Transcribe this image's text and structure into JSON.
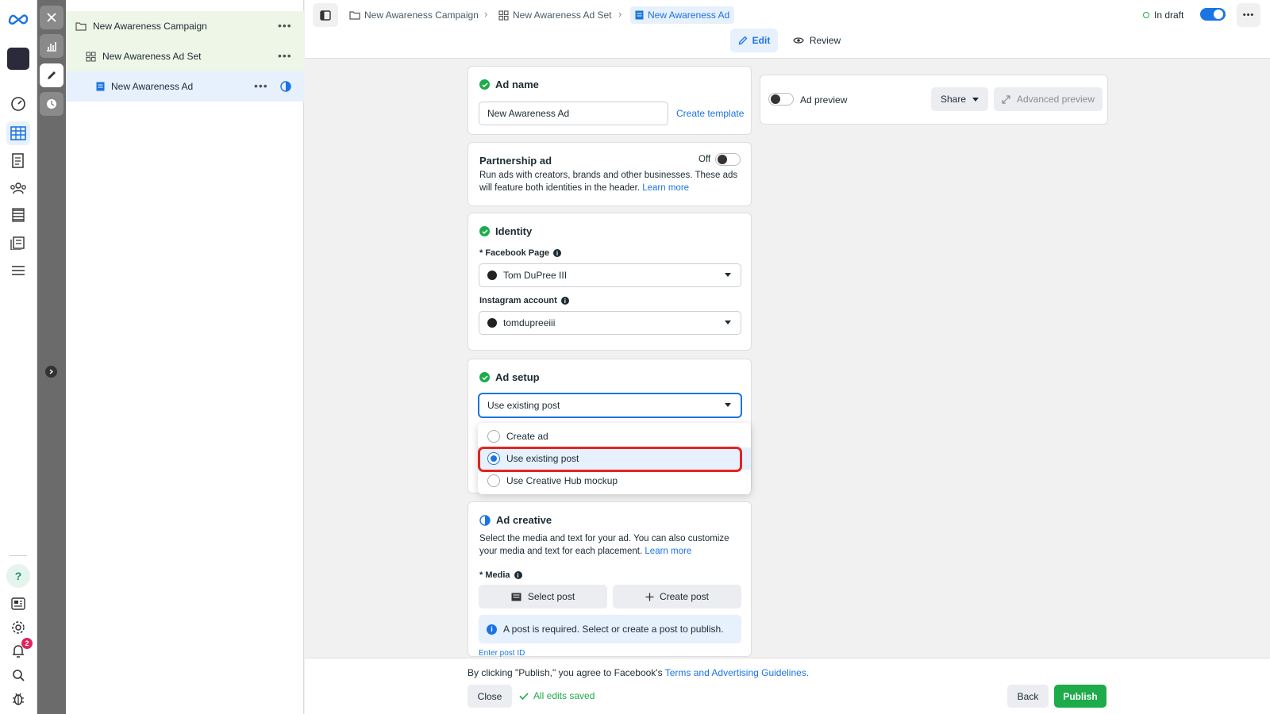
{
  "rail": {
    "notification_count": "2"
  },
  "tree": {
    "campaign": "New Awareness Campaign",
    "adset": "New Awareness Ad Set",
    "ad": "New Awareness Ad",
    "more": "•••"
  },
  "breadcrumb": {
    "campaign": "New Awareness Campaign",
    "adset": "New Awareness Ad Set",
    "ad": "New Awareness Ad"
  },
  "status": {
    "label": "In draft",
    "more": "•••"
  },
  "tabs": {
    "edit": "Edit",
    "review": "Review"
  },
  "ad_name": {
    "title": "Ad name",
    "value": "New Awareness Ad",
    "create_template": "Create template"
  },
  "partnership": {
    "title": "Partnership ad",
    "toggle_label": "Off",
    "description": "Run ads with creators, brands and other businesses. These ads will feature both identities in the header.",
    "learn_more": "Learn more"
  },
  "identity": {
    "title": "Identity",
    "facebook_page_label": "* Facebook Page",
    "facebook_page_value": "Tom DuPree III",
    "instagram_label": "Instagram account",
    "instagram_value": "tomdupreeiii"
  },
  "ad_setup": {
    "title": "Ad setup",
    "selected": "Use existing post",
    "options": [
      "Create ad",
      "Use existing post",
      "Use Creative Hub mockup"
    ]
  },
  "ad_creative": {
    "title": "Ad creative",
    "description": "Select the media and text for your ad. You can also customize your media and text for each placement.",
    "learn_more": "Learn more",
    "media_label": "* Media",
    "select_post": "Select post",
    "create_post": "Create post",
    "notice": "A post is required. Select or create a post to publish.",
    "enter_post_id": "Enter post ID"
  },
  "preview": {
    "label": "Ad preview",
    "share": "Share",
    "advanced": "Advanced preview"
  },
  "footer": {
    "terms_prefix": "By clicking \"Publish,\" you agree to Facebook's",
    "terms_link": "Terms and Advertising Guidelines.",
    "close": "Close",
    "saved": "All edits saved",
    "back": "Back",
    "publish": "Publish"
  },
  "colors": {
    "accent": "#1b74e4",
    "publish": "#1eab4a",
    "highlight": "#e0251f"
  }
}
